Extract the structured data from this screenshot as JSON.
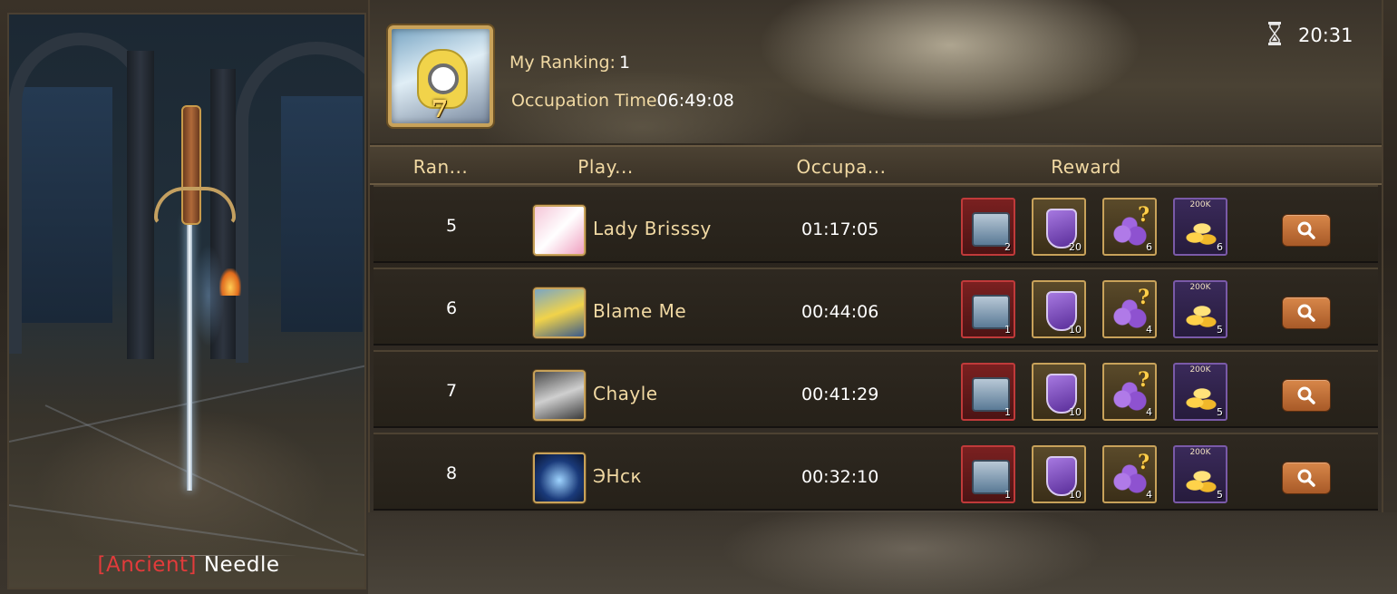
{
  "left_panel": {
    "item_rarity": "[Ancient]",
    "item_name": "Needle"
  },
  "header": {
    "my_ranking_label": "My Ranking:",
    "my_ranking_value": "1",
    "occupation_time_label": "Occupation Time",
    "occupation_time_value": "06:49:08",
    "avatar_badge": "7",
    "countdown": "20:31"
  },
  "table": {
    "headers": [
      "Ran...",
      "Play...",
      "Occupa...",
      "Reward"
    ],
    "rows": [
      {
        "rank": "5",
        "player": "Lady Brisssy",
        "time": "01:17:05",
        "rewards": [
          {
            "icon": "chest-icon",
            "qty": "2"
          },
          {
            "icon": "shield-icon",
            "qty": "20"
          },
          {
            "icon": "mystery-orbs-icon",
            "qty": "6"
          },
          {
            "icon": "gold-coins-icon",
            "label": "200K",
            "qty": "6"
          }
        ]
      },
      {
        "rank": "6",
        "player": "Blame Me",
        "time": "00:44:06",
        "rewards": [
          {
            "icon": "chest-icon",
            "qty": "1"
          },
          {
            "icon": "shield-icon",
            "qty": "10"
          },
          {
            "icon": "mystery-orbs-icon",
            "qty": "4"
          },
          {
            "icon": "gold-coins-icon",
            "label": "200K",
            "qty": "5"
          }
        ]
      },
      {
        "rank": "7",
        "player": "Chayle",
        "time": "00:41:29",
        "rewards": [
          {
            "icon": "chest-icon",
            "qty": "1"
          },
          {
            "icon": "shield-icon",
            "qty": "10"
          },
          {
            "icon": "mystery-orbs-icon",
            "qty": "4"
          },
          {
            "icon": "gold-coins-icon",
            "label": "200K",
            "qty": "5"
          }
        ]
      },
      {
        "rank": "8",
        "player": "ЭНск",
        "time": "00:32:10",
        "rewards": [
          {
            "icon": "chest-icon",
            "qty": "1"
          },
          {
            "icon": "shield-icon",
            "qty": "10"
          },
          {
            "icon": "mystery-orbs-icon",
            "qty": "4"
          },
          {
            "icon": "gold-coins-icon",
            "label": "200K",
            "qty": "5"
          }
        ]
      }
    ]
  },
  "colors": {
    "label_gold": "#f1d9a3",
    "rarity_red": "#e23b3b",
    "button_orange": "#c87038",
    "frame_gold": "#c8a25a"
  }
}
